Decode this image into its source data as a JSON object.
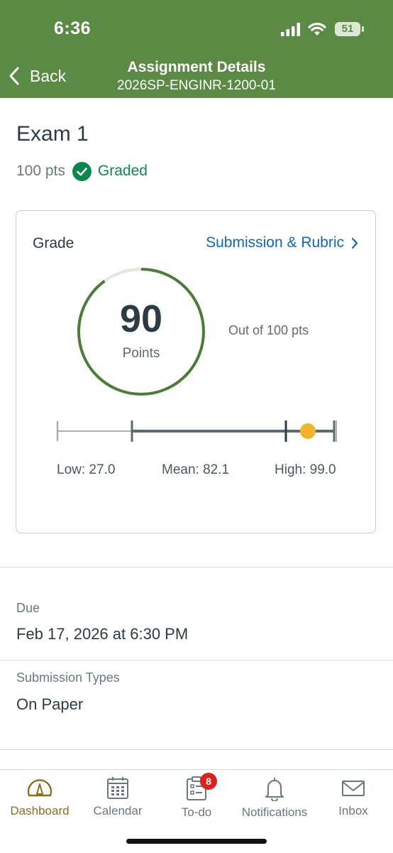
{
  "status_bar": {
    "time": "6:36",
    "battery": "51"
  },
  "nav": {
    "back_label": "Back",
    "title": "Assignment Details",
    "subtitle": "2026SP-ENGINR-1200-01"
  },
  "assignment": {
    "title": "Exam 1",
    "points": "100 pts",
    "status": "Graded"
  },
  "grade_card": {
    "heading": "Grade",
    "link_label": "Submission & Rubric",
    "score": "90",
    "score_unit": "Points",
    "out_of": "Out of 100 pts",
    "score_fraction": 0.9,
    "stats": {
      "low": "Low: 27.0",
      "mean": "Mean: 82.1",
      "high": "High: 99.0"
    }
  },
  "details": [
    {
      "label": "Due",
      "value": "Feb 17, 2026 at 6:30 PM"
    },
    {
      "label": "Submission Types",
      "value": "On Paper"
    }
  ],
  "tabs": [
    {
      "label": "Dashboard",
      "icon": "dashboard-gauge-icon",
      "active": true
    },
    {
      "label": "Calendar",
      "icon": "calendar-icon"
    },
    {
      "label": "To-do",
      "icon": "todo-clipboard-icon",
      "badge": "8"
    },
    {
      "label": "Notifications",
      "icon": "bell-icon"
    },
    {
      "label": "Inbox",
      "icon": "envelope-icon"
    }
  ],
  "colors": {
    "header": "#5a8a44",
    "graded": "#0b874b",
    "link": "#0e68b3",
    "active_tab": "#8a6d1e",
    "score_marker": "#f0b52d",
    "badge": "#e0201b"
  }
}
